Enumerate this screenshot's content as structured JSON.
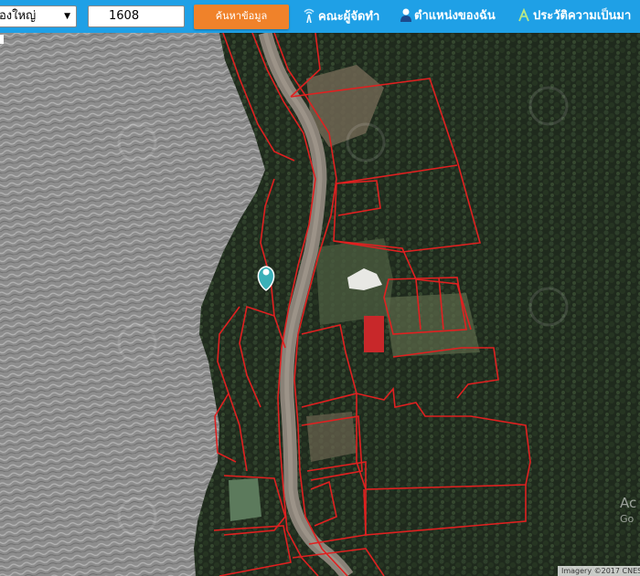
{
  "toolbar": {
    "district_select": "องใหญ่",
    "parcel_number": "1608",
    "search_button": "ค้นหาข้อมูล",
    "links": [
      {
        "label": "คณะผู้จัดทำ",
        "icon": "antenna-icon"
      },
      {
        "label": "ตำแหน่งของฉัน",
        "icon": "person-icon"
      },
      {
        "label": "ประวัติความเป็นมา",
        "icon": "history-icon"
      }
    ]
  },
  "map": {
    "attribution": "Imagery ©2017 CNES",
    "watermark_line1": "Ac",
    "watermark_line2": "Go"
  },
  "colors": {
    "toolbar": "#1fa0e6",
    "button": "#f0822a",
    "parcel_lines": "#e02020",
    "marker": "#3ab0b8"
  }
}
